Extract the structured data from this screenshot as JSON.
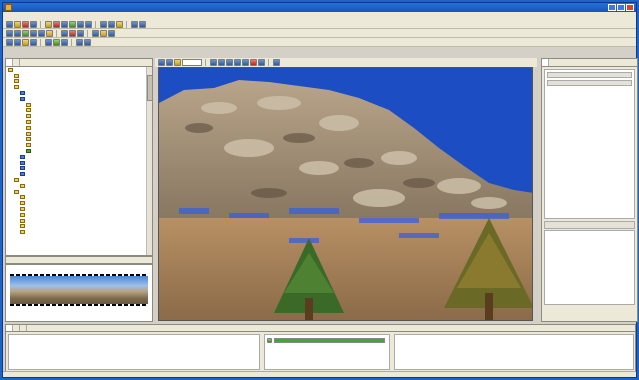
{
  "window": {
    "title": ""
  },
  "menu": [
    "",
    "",
    "",
    "",
    "",
    "",
    ""
  ],
  "left_panel": {
    "tabs": [
      "",
      ""
    ],
    "tree": [
      {
        "text": "",
        "indent": 0,
        "icon": "folder"
      },
      {
        "text": "",
        "indent": 1,
        "icon": "folder"
      },
      {
        "text": "",
        "indent": 1,
        "icon": "folder"
      },
      {
        "text": "",
        "indent": 1,
        "icon": "folder"
      },
      {
        "text": "",
        "indent": 2,
        "icon": "scan"
      },
      {
        "text": "",
        "indent": 2,
        "icon": "scan"
      },
      {
        "text": "",
        "indent": 3,
        "icon": "folder"
      },
      {
        "text": "",
        "indent": 3,
        "icon": "folder"
      },
      {
        "text": "",
        "indent": 3,
        "icon": "folder"
      },
      {
        "text": "",
        "indent": 3,
        "icon": "folder"
      },
      {
        "text": "",
        "indent": 3,
        "icon": "folder"
      },
      {
        "text": "",
        "indent": 3,
        "icon": "folder"
      },
      {
        "text": "",
        "indent": 3,
        "icon": "folder"
      },
      {
        "text": "",
        "indent": 3,
        "icon": "folder"
      },
      {
        "text": "",
        "indent": 3,
        "icon": "img",
        "selected": true
      },
      {
        "text": "",
        "indent": 2,
        "icon": "scan"
      },
      {
        "text": "",
        "indent": 2,
        "icon": "scan"
      },
      {
        "text": "",
        "indent": 2,
        "icon": "scan"
      },
      {
        "text": "",
        "indent": 2,
        "icon": "scan"
      },
      {
        "text": "",
        "indent": 1,
        "icon": "folder"
      },
      {
        "text": "",
        "indent": 2,
        "icon": "folder"
      },
      {
        "text": "",
        "indent": 1,
        "icon": "folder"
      },
      {
        "text": "",
        "indent": 2,
        "icon": "folder"
      },
      {
        "text": "",
        "indent": 2,
        "icon": "folder"
      },
      {
        "text": "",
        "indent": 2,
        "icon": "folder"
      },
      {
        "text": "",
        "indent": 2,
        "icon": "folder"
      },
      {
        "text": "",
        "indent": 2,
        "icon": "folder"
      },
      {
        "text": "",
        "indent": 2,
        "icon": "folder"
      },
      {
        "text": "",
        "indent": 2,
        "icon": "folder"
      }
    ]
  },
  "preview": {
    "title": ""
  },
  "view_toolbar": {
    "zoom": ""
  },
  "right_panel": {
    "tab": "",
    "buttons": [
      "",
      ""
    ],
    "properties_title": "",
    "footer": ""
  },
  "bottom": {
    "tabs": [
      "",
      "",
      ""
    ],
    "log_lines": [
      {
        "text": "",
        "big": false
      },
      {
        "text": "",
        "big": true
      },
      {
        "text": "",
        "big": false
      },
      {
        "text": "",
        "big": false
      },
      {
        "text": "",
        "big": false
      },
      {
        "text": "",
        "big": true
      },
      {
        "text": "",
        "big": false
      }
    ],
    "progress": {
      "label": "",
      "percent": 100,
      "value_text": ""
    },
    "info": {
      "title": "",
      "lines": [
        "",
        "",
        "",
        "",
        ""
      ]
    }
  }
}
